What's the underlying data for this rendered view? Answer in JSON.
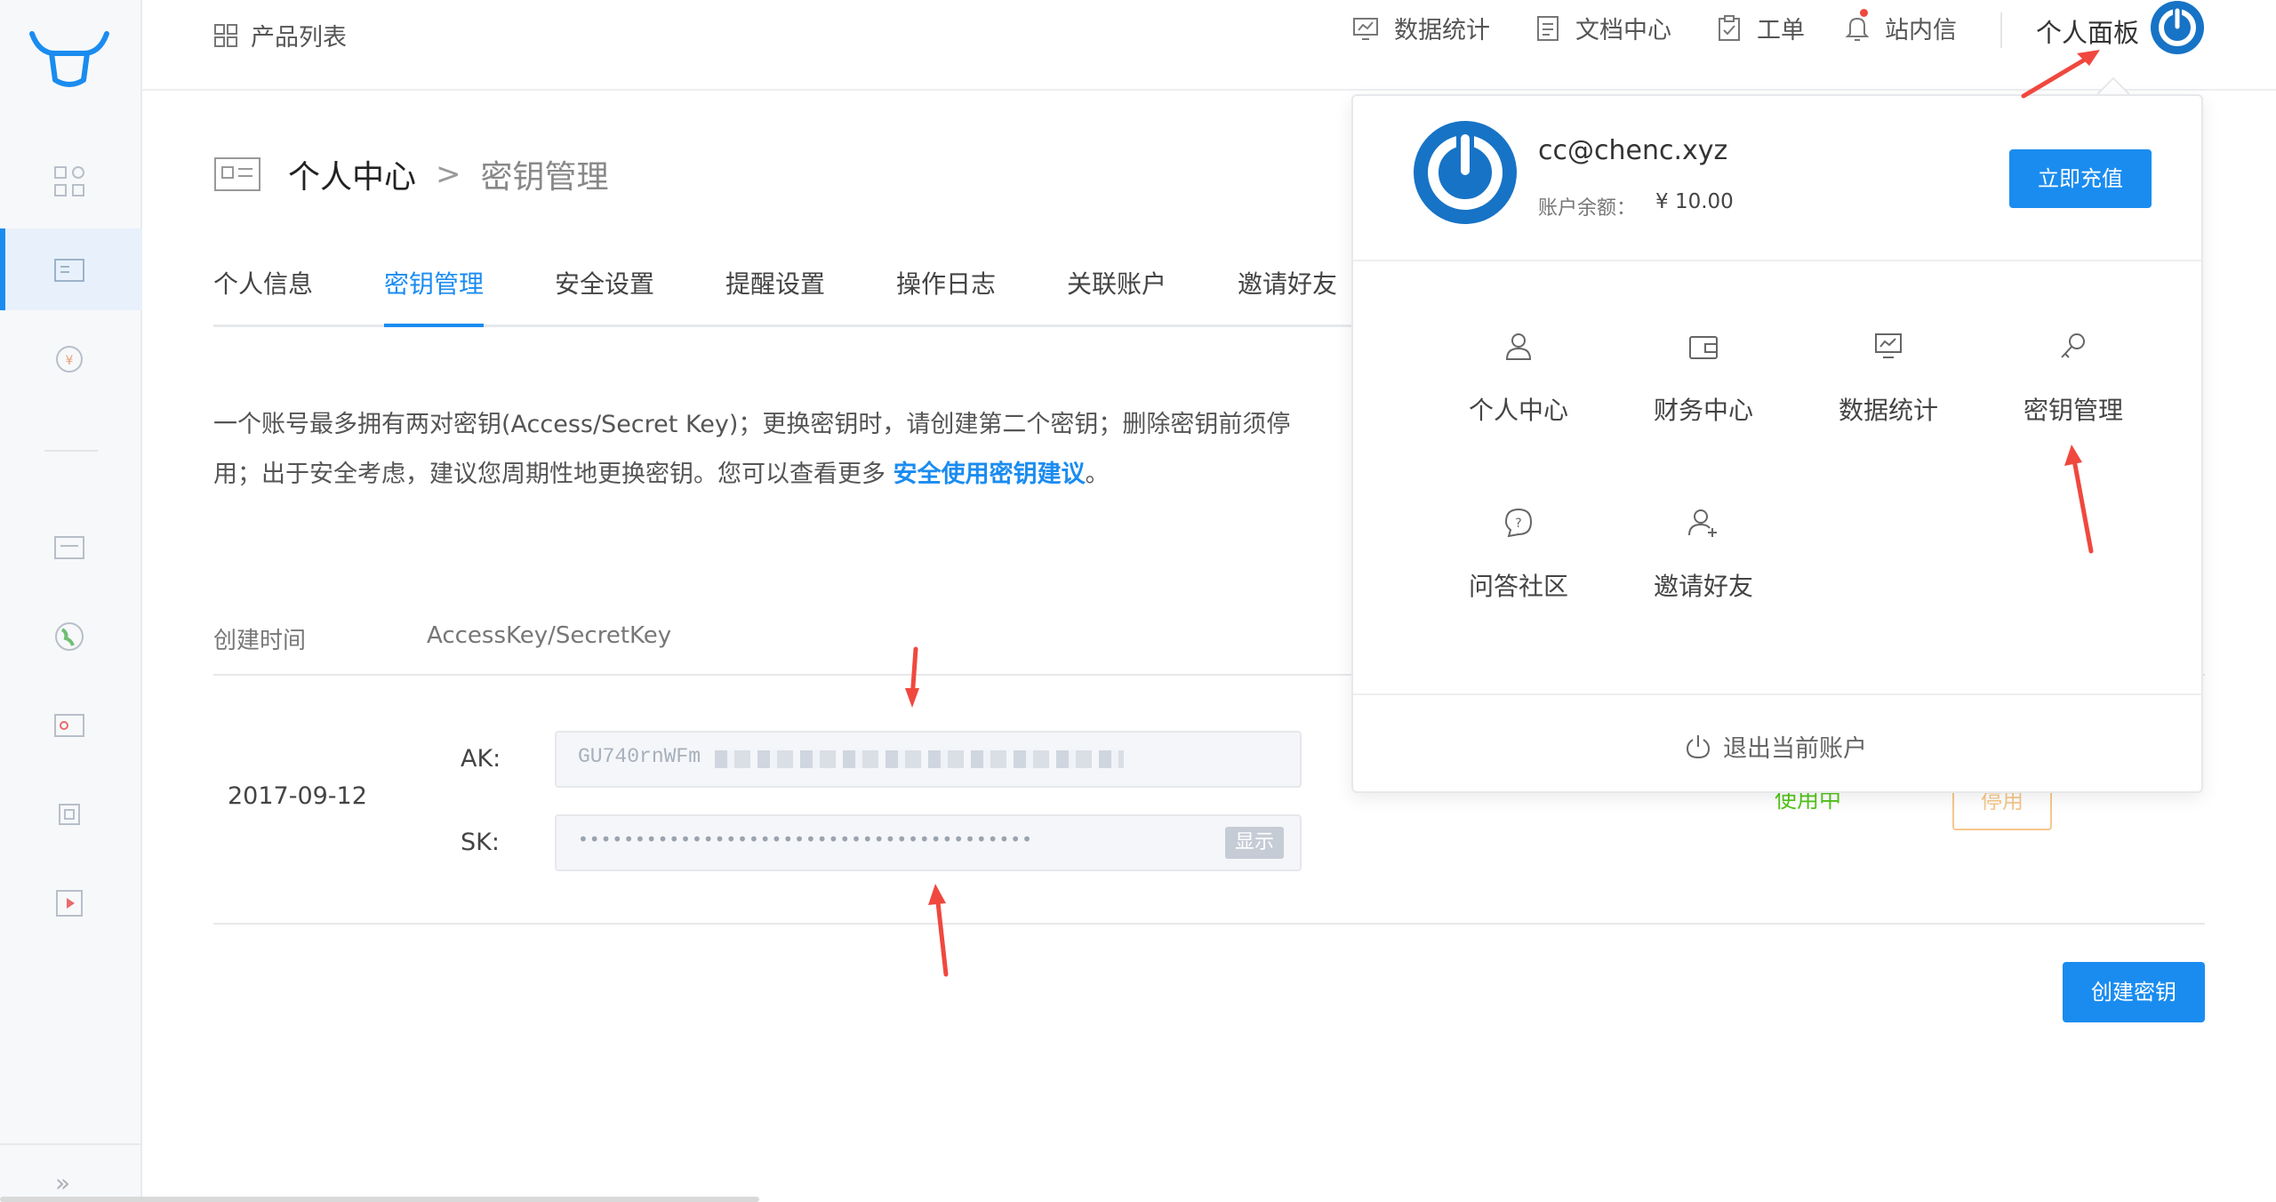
{
  "header": {
    "product_list": "产品列表",
    "nav": [
      {
        "label": "数据统计",
        "icon": "chart-icon"
      },
      {
        "label": "文档中心",
        "icon": "document-icon"
      },
      {
        "label": "工单",
        "icon": "clipboard-icon"
      },
      {
        "label": "站内信",
        "icon": "bell-icon"
      }
    ],
    "panel_label": "个人面板"
  },
  "breadcrumb": {
    "current": "个人中心",
    "separator": ">",
    "sub": "密钥管理"
  },
  "tabs": [
    "个人信息",
    "密钥管理",
    "安全设置",
    "提醒设置",
    "操作日志",
    "关联账户",
    "邀请好友"
  ],
  "active_tab": "密钥管理",
  "description": {
    "line1": "一个账号最多拥有两对密钥(Access/Secret Key)；更换密钥时，请创建第二个密钥；删除密钥前须停",
    "line2": "用；出于安全考虑，建议您周期性地更换密钥。您可以查看更多 ",
    "link": "安全使用密钥建议",
    "line2_end": "。"
  },
  "table": {
    "headers": [
      "创建时间",
      "AccessKey/SecretKey"
    ],
    "rows": [
      {
        "date": "2017-09-12",
        "ak_label": "AK:",
        "ak_value": "GU740rnWFm",
        "sk_label": "SK:",
        "sk_value": "••••••••••••••••••••••••••••••••••••••••",
        "show_label": "显示",
        "status": "使用中",
        "action": "停用"
      }
    ]
  },
  "create_button": "创建密钥",
  "dropdown": {
    "email": "cc@chenc.xyz",
    "balance_label": "账户余额：",
    "balance_value": "¥ 10.00",
    "recharge": "立即充值",
    "items": [
      {
        "label": "个人中心",
        "icon": "user-icon"
      },
      {
        "label": "财务中心",
        "icon": "wallet-icon"
      },
      {
        "label": "数据统计",
        "icon": "chart-icon"
      },
      {
        "label": "密钥管理",
        "icon": "key-icon"
      },
      {
        "label": "问答社区",
        "icon": "question-icon"
      },
      {
        "label": "邀请好友",
        "icon": "add-user-icon"
      }
    ],
    "logout": "退出当前账户"
  },
  "colors": {
    "accent": "#1a8cf0",
    "annotation_arrow": "#f0483e",
    "status_active": "#52c41a",
    "disable_border": "#f5c78b"
  }
}
